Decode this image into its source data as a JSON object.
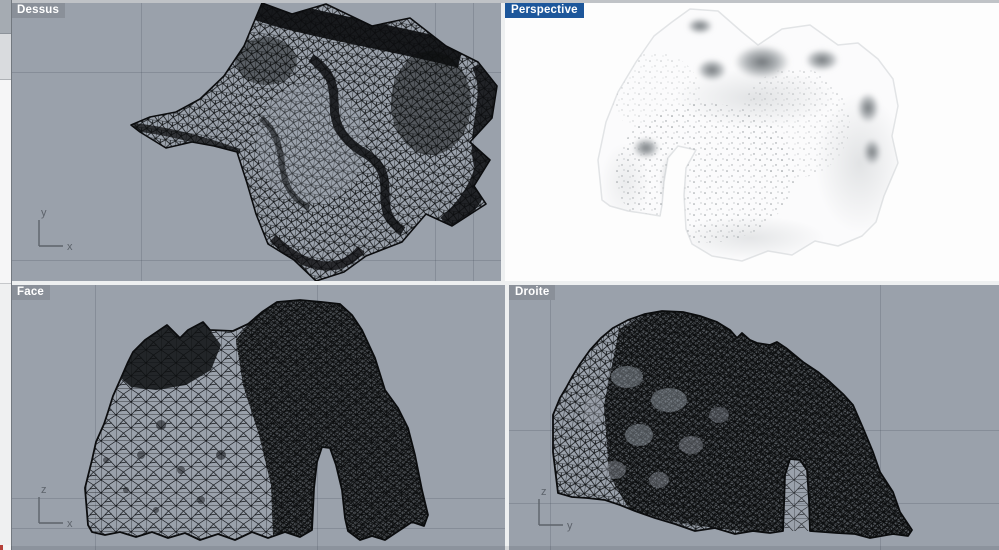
{
  "colors": {
    "viewport_background": "#9aa1ab",
    "perspective_background": "#fdfdfd",
    "active_label_background": "#1d579b",
    "inactive_label_background": "#8a9099",
    "label_text": "#ffffff",
    "mesh_wireframe": "#101214",
    "axis_icon": "#5d636b"
  },
  "viewports": [
    {
      "id": "dessus",
      "label": "Dessus",
      "active": false,
      "axis": {
        "vertical": "y",
        "horizontal": "x"
      }
    },
    {
      "id": "perspective",
      "label": "Perspective",
      "active": true
    },
    {
      "id": "face",
      "label": "Face",
      "active": false,
      "axis": {
        "vertical": "z",
        "horizontal": "x"
      }
    },
    {
      "id": "droite",
      "label": "Droite",
      "active": false,
      "axis": {
        "vertical": "z",
        "horizontal": "y"
      }
    }
  ]
}
